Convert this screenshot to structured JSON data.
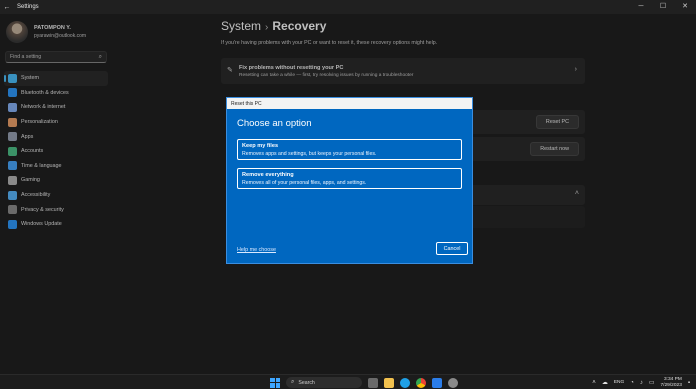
{
  "window": {
    "title": "Settings",
    "back_icon": "back-arrow-icon",
    "controls": [
      "─",
      "☐",
      "✕"
    ]
  },
  "profile": {
    "name": "PATOMPON Y.",
    "email": "pyarawin@outlook.com"
  },
  "search": {
    "placeholder": "Find a setting"
  },
  "nav": {
    "items": [
      {
        "label": "System",
        "icon": "system-icon",
        "color": "#4cc2ff",
        "active": true
      },
      {
        "label": "Bluetooth & devices",
        "icon": "bluetooth-icon",
        "color": "#2f9bff"
      },
      {
        "label": "Network & internet",
        "icon": "network-icon",
        "color": "#8ab4f8"
      },
      {
        "label": "Personalization",
        "icon": "personalization-icon",
        "color": "#f0a36b"
      },
      {
        "label": "Apps",
        "icon": "apps-icon",
        "color": "#9aa3b5"
      },
      {
        "label": "Accounts",
        "icon": "accounts-icon",
        "color": "#4fc38a"
      },
      {
        "label": "Time & language",
        "icon": "time-language-icon",
        "color": "#4aa8ff"
      },
      {
        "label": "Gaming",
        "icon": "gaming-icon",
        "color": "#b8b8b8"
      },
      {
        "label": "Accessibility",
        "icon": "accessibility-icon",
        "color": "#5bb8ff"
      },
      {
        "label": "Privacy & security",
        "icon": "privacy-shield-icon",
        "color": "#8e8e8e"
      },
      {
        "label": "Windows Update",
        "icon": "windows-update-icon",
        "color": "#2f9bff"
      }
    ]
  },
  "main": {
    "breadcrumb_parent": "System",
    "breadcrumb_separator": "›",
    "breadcrumb_current": "Recovery",
    "description": "If you're having problems with your PC or want to reset it, these recovery options might help.",
    "fix_card": {
      "title": "Fix problems without resetting your PC",
      "subtitle": "Resetting can take a while — first, try resolving issues by running a troubleshooter"
    },
    "reset_button": "Reset PC",
    "restart_button": "Restart now"
  },
  "dialog": {
    "title": "Reset this PC",
    "heading": "Choose an option",
    "options": [
      {
        "title": "Keep my files",
        "desc": "Removes apps and settings, but keeps your personal files."
      },
      {
        "title": "Remove everything",
        "desc": "Removes all of your personal files, apps, and settings."
      }
    ],
    "help_link": "Help me choose",
    "cancel": "Cancel"
  },
  "taskbar": {
    "search_label": "Search",
    "lang": "ENG",
    "time": "3:34 PM",
    "date": "7/29/2023"
  },
  "colors": {
    "accent": "#4cc2ff",
    "dialog_bg": "#0067c0"
  }
}
